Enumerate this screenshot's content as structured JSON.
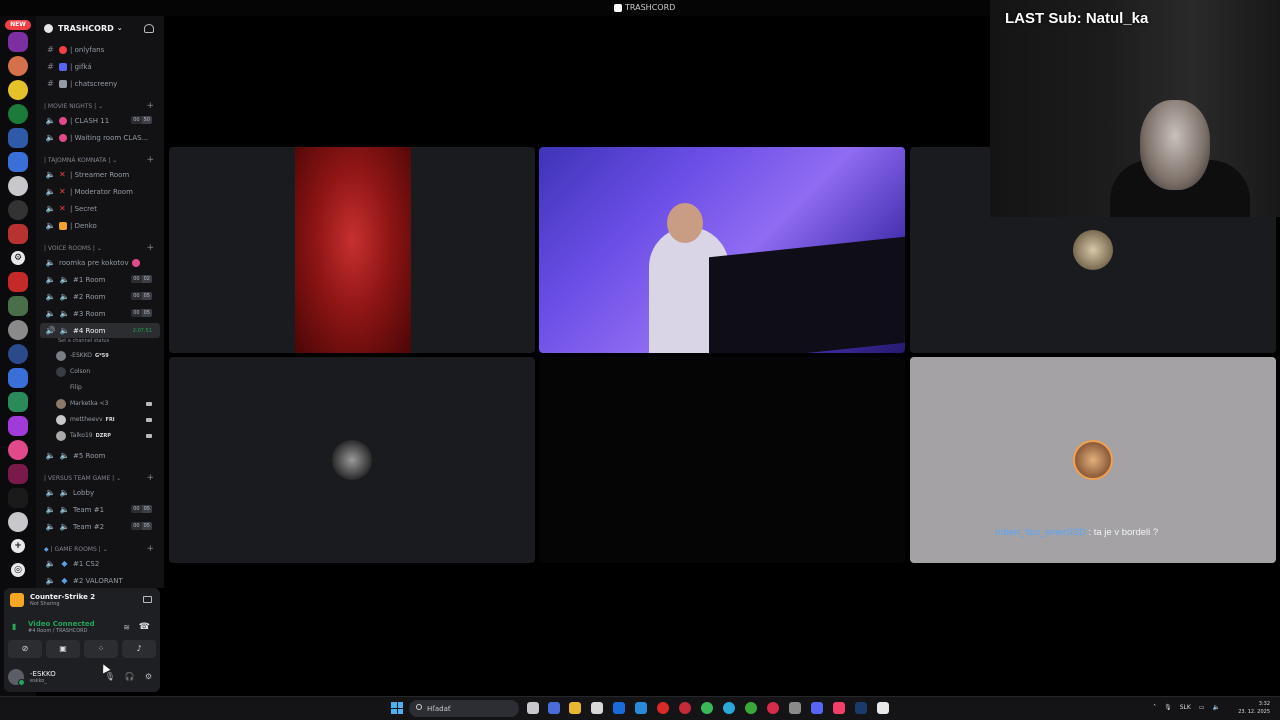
{
  "window": {
    "title": "TRASHCORD"
  },
  "rail": {
    "new_badge": "NEW"
  },
  "server": {
    "name": "TRASHCORD"
  },
  "channels_top": [
    {
      "label": "| onlyfans",
      "color": "#f23f43"
    },
    {
      "label": "| gifká",
      "color": "#5865f2"
    },
    {
      "label": "| chatscreeny",
      "color": "#949ba4"
    }
  ],
  "categories": {
    "movie": "| movie nights |",
    "tajomna": "| TAJOMNÁ KOMNATA |",
    "voice": "| VOICE ROOMS |",
    "versus": "| VERSUS TEAM GAME |",
    "game": "| GAME ROOMS |"
  },
  "movie_channels": [
    {
      "label": "| CLASH 11",
      "c1": "00",
      "c2": "50"
    },
    {
      "label": "| Waiting room CLAS..."
    }
  ],
  "tajomna_channels": [
    {
      "label": "| Streamer Room"
    },
    {
      "label": "| Moderator Room"
    },
    {
      "label": "| Secret"
    },
    {
      "label": "| Denko"
    }
  ],
  "voice_channels": [
    {
      "label": "roomka pre kokotov"
    },
    {
      "label": "#1 Room",
      "c1": "00",
      "c2": "02"
    },
    {
      "label": "#2 Room",
      "c1": "00",
      "c2": "05"
    },
    {
      "label": "#3 Room",
      "c1": "00",
      "c2": "05"
    },
    {
      "label": "#4 Room",
      "timer": "2:07:51"
    }
  ],
  "room4_status": "Set a channel status",
  "members": [
    {
      "name": "-ESKKO",
      "tag": "G*59"
    },
    {
      "name": "Colson"
    },
    {
      "name": "Filip"
    },
    {
      "name": "Marketka <3"
    },
    {
      "name": "mettheevv",
      "tag": "FRI"
    },
    {
      "name": "Talko19",
      "tag": "DZRP"
    }
  ],
  "room5": "#5 Room",
  "versus_channels": [
    {
      "label": "Lobby"
    },
    {
      "label": "Team #1",
      "c1": "00",
      "c2": "05"
    },
    {
      "label": "Team #2",
      "c1": "00",
      "c2": "05"
    }
  ],
  "game_channels": [
    {
      "label": "#1 CS2"
    },
    {
      "label": "#2 VALORANT"
    }
  ],
  "panel": {
    "game": "Counter-Strike 2",
    "game_status": "Not Sharing",
    "video": "Video Connected",
    "video_sub": "#4 Room / TRASHCORD",
    "user": "-ESKKO",
    "user_sub": "eskko_"
  },
  "chat": {
    "user": "robert_fico_smerSSD",
    "text": " : ta je v bordeli ?"
  },
  "webcam": {
    "sub": "LAST Sub: Natul_ka"
  },
  "taskbar": {
    "search": "Hľadať",
    "lang": "SLK",
    "time": "3:32",
    "date": "23. 12. 2025"
  }
}
